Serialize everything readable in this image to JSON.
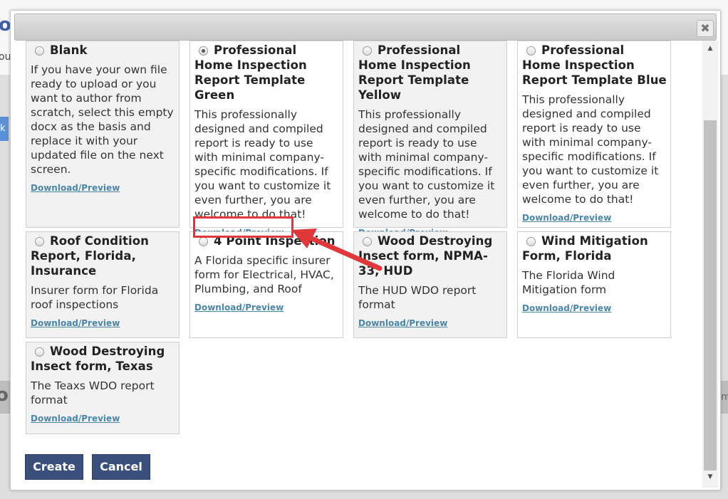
{
  "background": {
    "logo_fragment": "oc",
    "text_fragment": "ou",
    "button_fragment": "k",
    "bar_left_fragment": "o",
    "bar_right_fragment": "m"
  },
  "dialog": {
    "close_glyph": "✖",
    "cards": [
      {
        "title": "Blank",
        "selected": false,
        "description": "If you have your own file ready to upload or you want to author from scratch, select this empty docx as the basis and replace it with your updated file on the next screen.",
        "link": "Download/Preview"
      },
      {
        "title": "Professional Home Inspection Report Template Green",
        "selected": true,
        "description": "This professionally designed and compiled report is ready to use with minimal company-specific modifications. If you want to customize it even further, you are welcome to do that!",
        "link": "Download/Preview"
      },
      {
        "title": "Professional Home Inspection Report Template Yellow",
        "selected": false,
        "description": "This professionally designed and compiled report is ready to use with minimal company-specific modifications. If you want to customize it even further, you are welcome to do that!",
        "link": "Download/Preview"
      },
      {
        "title": "Professional Home Inspection Report Template Blue",
        "selected": false,
        "description": "This professionally designed and compiled report is ready to use with minimal company-specific modifications. If you want to customize it even further, you are welcome to do that!",
        "link": "Download/Preview"
      },
      {
        "title": "Roof Condition Report, Florida, Insurance",
        "selected": false,
        "description": "Insurer form for Florida roof inspections",
        "link": "Download/Preview"
      },
      {
        "title": "4 Point Inspection",
        "selected": false,
        "description": "A Florida specific insurer form for Electrical, HVAC, Plumbing, and Roof",
        "link": "Download/Preview"
      },
      {
        "title": "Wood Destroying Insect form, NPMA-33, HUD",
        "selected": false,
        "description": "The HUD WDO report format",
        "link": "Download/Preview"
      },
      {
        "title": "Wind Mitigation Form, Florida",
        "selected": false,
        "description": "The Florida Wind Mitigation form",
        "link": "Download/Preview"
      },
      {
        "title": "Wood Destroying Insect form, Texas",
        "selected": false,
        "description": "The Teaxs WDO report format",
        "link": "Download/Preview"
      }
    ],
    "buttons": {
      "create": "Create",
      "cancel": "Cancel"
    }
  },
  "colors": {
    "accent_button": "#3b4f7d",
    "link": "#4a86a8",
    "annotation_red": "#e0373a"
  }
}
